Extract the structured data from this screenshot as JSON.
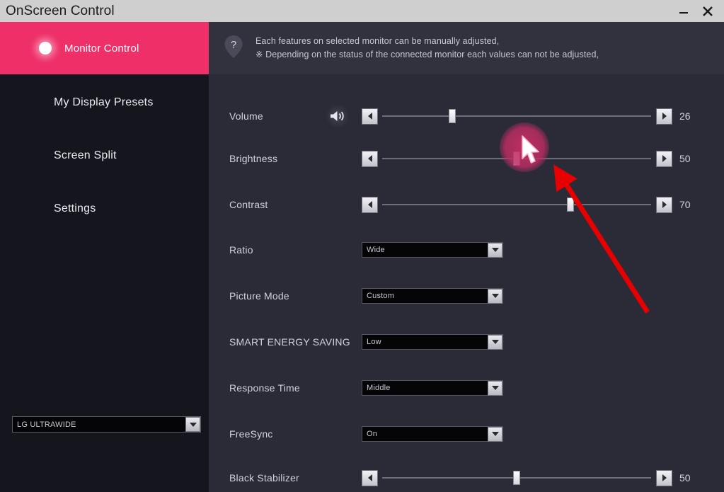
{
  "window": {
    "title": "OnScreen Control",
    "minimize_label": "Minimize",
    "close_label": "Close"
  },
  "sidebar": {
    "active_item": {
      "label": "Monitor Control",
      "icon": "circle-dot-icon"
    },
    "items": [
      {
        "label": "My Display Presets"
      },
      {
        "label": "Screen Split"
      },
      {
        "label": "Settings"
      }
    ],
    "monitor_select": {
      "value": "LG ULTRAWIDE",
      "icon": "chevron-down-icon"
    }
  },
  "help": {
    "icon": "help-question-icon",
    "line1": "Each features on selected monitor can be manually adjusted,",
    "line2": "※ Depending on the status of the connected monitor each values can not be adjusted,"
  },
  "controls": {
    "sliders": [
      {
        "label": "Volume",
        "value": "26",
        "percent": 26,
        "icon": "speaker-icon",
        "dec_label": "Decrease",
        "inc_label": "Increase"
      },
      {
        "label": "Brightness",
        "value": "50",
        "percent": 50,
        "icon": "",
        "dec_label": "Decrease",
        "inc_label": "Increase"
      },
      {
        "label": "Contrast",
        "value": "70",
        "percent": 70,
        "icon": "",
        "dec_label": "Decrease",
        "inc_label": "Increase"
      },
      {
        "label": "Black Stabilizer",
        "value": "50",
        "percent": 50,
        "icon": "",
        "dec_label": "Decrease",
        "inc_label": "Increase"
      }
    ],
    "selects": [
      {
        "label": "Ratio",
        "value": "Wide",
        "icon": "chevron-down-icon"
      },
      {
        "label": "Picture Mode",
        "value": "Custom",
        "icon": "chevron-down-icon"
      },
      {
        "label": "SMART ENERGY SAVING",
        "value": "Low",
        "icon": "chevron-down-icon"
      },
      {
        "label": "Response Time",
        "value": "Middle",
        "icon": "chevron-down-icon"
      },
      {
        "label": "FreeSync",
        "value": "On",
        "icon": "chevron-down-icon"
      }
    ]
  },
  "annotations": {
    "click_highlight": {
      "icon": "click-halo",
      "color": "#c82d64"
    },
    "cursor": {
      "icon": "mouse-pointer-icon"
    },
    "arrow": {
      "icon": "red-arrow-icon",
      "color": "#e60000"
    }
  },
  "colors": {
    "accent_pink": "#ee2f68",
    "sidebar_bg": "#15151d",
    "panel_bg": "#2b2b38",
    "helpbar_bg": "#32323e",
    "titlebar_bg": "#cfcfcf",
    "text": "#d2d2dc"
  }
}
